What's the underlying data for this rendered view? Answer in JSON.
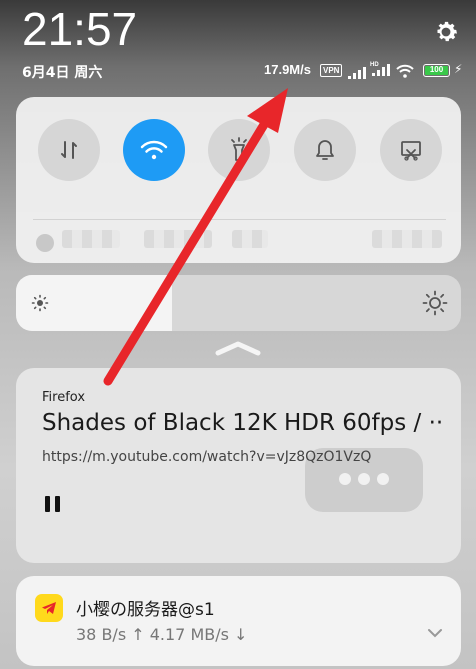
{
  "status_bar": {
    "time": "21:57",
    "date": "6月4日 周六",
    "net_speed": "17.9M/s",
    "vpn_badge": "VPN",
    "hd_label": "HD",
    "battery": "100",
    "battery_level": 1.0
  },
  "quick_settings": {
    "tiles": [
      {
        "name": "mobile-data",
        "on": false
      },
      {
        "name": "wifi",
        "on": true
      },
      {
        "name": "flashlight",
        "on": false
      },
      {
        "name": "notifications",
        "on": false
      },
      {
        "name": "screenshot",
        "on": false
      }
    ]
  },
  "brightness": {
    "level": 0.35
  },
  "media": {
    "app": "Firefox",
    "title": "Shades of Black 12K HDR 60fps / ··",
    "url": "https://m.youtube.com/watch?v=vJz8QzO1VzQ"
  },
  "notification": {
    "title": "小樱の服务器@s1",
    "stats": "38 B/s ↑  4.17 MB/s ↓"
  },
  "colors": {
    "accent": "#1e9bf5",
    "arrow": "#e8262a",
    "battery": "#3ac84a",
    "app_icon": "#ffd91c"
  }
}
